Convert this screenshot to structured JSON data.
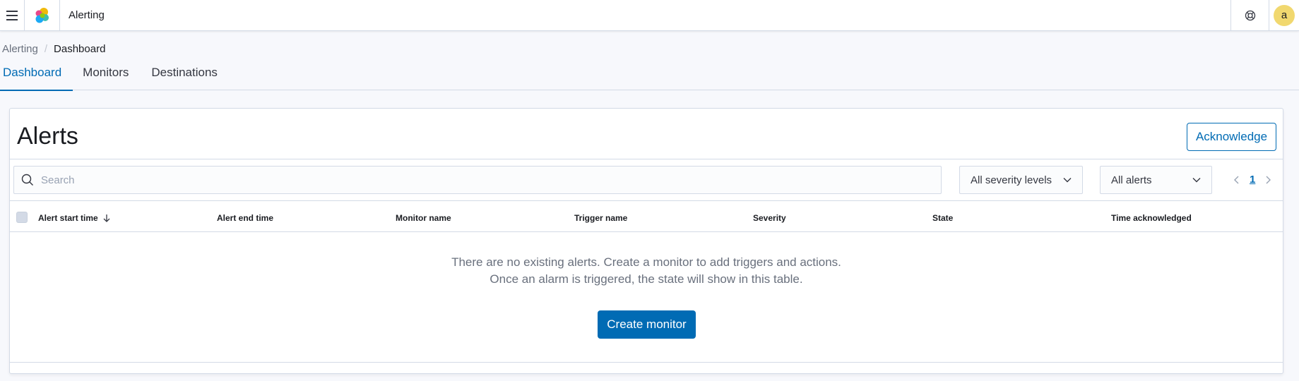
{
  "header": {
    "app_title": "Alerting",
    "menu_icon": "hamburger-menu-icon",
    "logo_icon": "elastic-logo-icon",
    "help_icon": "help-icon",
    "avatar_initial": "a",
    "avatar_color": "#f1d86f"
  },
  "breadcrumb": {
    "parent": "Alerting",
    "current": "Dashboard"
  },
  "tabs": [
    {
      "label": "Dashboard",
      "active": true
    },
    {
      "label": "Monitors",
      "active": false
    },
    {
      "label": "Destinations",
      "active": false
    }
  ],
  "alerts_panel": {
    "title": "Alerts",
    "acknowledge_label": "Acknowledge",
    "search_placeholder": "Search",
    "severity_select": "All severity levels",
    "state_select": "All alerts",
    "current_page": "1",
    "columns": [
      "Alert start time",
      "Alert end time",
      "Monitor name",
      "Trigger name",
      "Severity",
      "State",
      "Time acknowledged"
    ],
    "sort_column": "Alert start time",
    "sort_direction": "descending",
    "empty_line1": "There are no existing alerts. Create a monitor to add triggers and actions.",
    "empty_line2": "Once an alarm is triggered, the state will show in this table.",
    "create_button_label": "Create monitor"
  },
  "colors": {
    "accent": "#006bb4",
    "border": "#d3dae6",
    "page_background": "#f7f8fc"
  }
}
